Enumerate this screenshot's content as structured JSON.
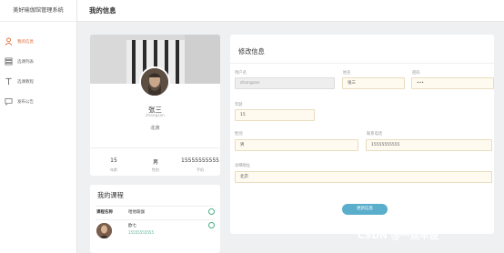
{
  "app": {
    "title": "美好瑜伽馆管理系统"
  },
  "header": {
    "title": "我的信息"
  },
  "sidebar": {
    "items": [
      {
        "label": "我的信息",
        "icon": "user-icon",
        "active": true
      },
      {
        "label": "选课列表",
        "icon": "list-icon",
        "active": false
      },
      {
        "label": "选课教程",
        "icon": "text-icon",
        "active": false
      },
      {
        "label": "发布公告",
        "icon": "message-icon",
        "active": false
      }
    ]
  },
  "profile": {
    "name": "张三",
    "username": "zhangsan",
    "address": "北京",
    "stats": [
      {
        "value": "15",
        "label": "年龄"
      },
      {
        "value": "男",
        "label": "性别"
      },
      {
        "value": "15555555555",
        "label": "手机"
      }
    ]
  },
  "courses": {
    "title": "我的课程",
    "headers": {
      "name": "课程名称",
      "course": "哈他瑜伽"
    },
    "students": [
      {
        "name": "欧七",
        "phone": "15555555555"
      }
    ]
  },
  "form": {
    "title": "修改信息",
    "username_label": "用户名",
    "username": "zhangsan",
    "name_label": "姓名",
    "name": "张三",
    "password_label": "密码",
    "password": "•••",
    "age_label": "年龄",
    "age": "15",
    "gender_label": "性别",
    "gender": "男",
    "phone_label": "联系电话",
    "phone": "15555555555",
    "address_label": "详细地址",
    "address": "北京",
    "submit_label": "更新信息"
  },
  "watermark": "CSDN @一点毕设",
  "colors": {
    "accent": "#e06a3a",
    "submit": "#5aaecb",
    "radio": "#4caf85"
  }
}
